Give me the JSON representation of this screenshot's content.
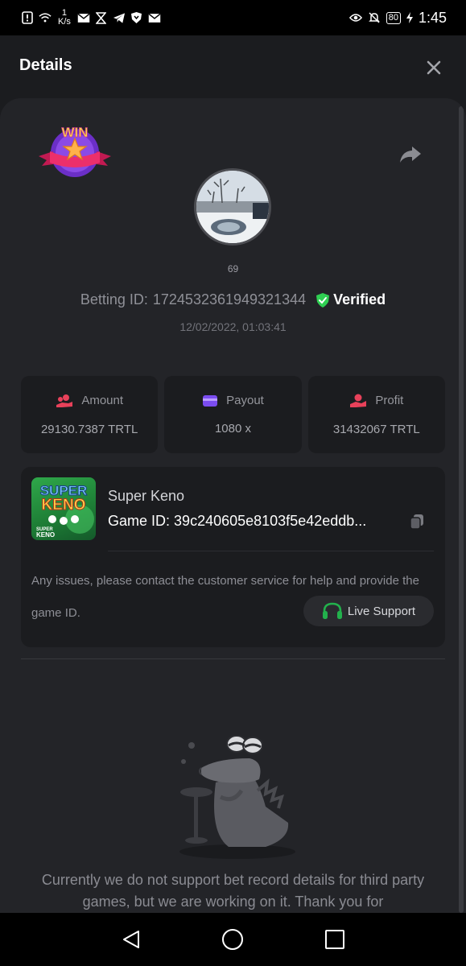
{
  "status_bar": {
    "net_speed_value": "1",
    "net_speed_unit": "K/s",
    "battery": "80",
    "time": "1:45"
  },
  "header": {
    "title": "Details"
  },
  "bet": {
    "username": "69",
    "betting_id_label": "Betting ID:",
    "betting_id": "1724532361949321344",
    "verified_label": "Verified",
    "datetime": "12/02/2022, 01:03:41",
    "badge_text": "WIN"
  },
  "stats": [
    {
      "label": "Amount",
      "value": "29130.7387 TRTL",
      "icon": "coins-hand-icon",
      "color": "#e8415a"
    },
    {
      "label": "Payout",
      "value": "1080 x",
      "icon": "wallet-icon",
      "color": "#7b4cf0"
    },
    {
      "label": "Profit",
      "value": "31432067 TRTL",
      "icon": "profit-hand-icon",
      "color": "#e8415a"
    }
  ],
  "game": {
    "name": "Super Keno",
    "id_label": "Game ID:",
    "id": "39c240605e8103f5e42eddb...",
    "issue_text": "Any issues, please contact the customer service for help and provide the game ID.",
    "support_label": "Live Support",
    "thumb_title_1": "SUPER",
    "thumb_title_2": "KENO",
    "thumb_sub_1": "SUPER",
    "thumb_sub_2": "KENO"
  },
  "notice": "Currently we do not support bet record details for third party games, but we are working on it. Thank you for",
  "colors": {
    "accent_green": "#22b14c",
    "verified_green": "#2fcf52",
    "background": "#1b1c1f",
    "sheet": "#232428"
  }
}
